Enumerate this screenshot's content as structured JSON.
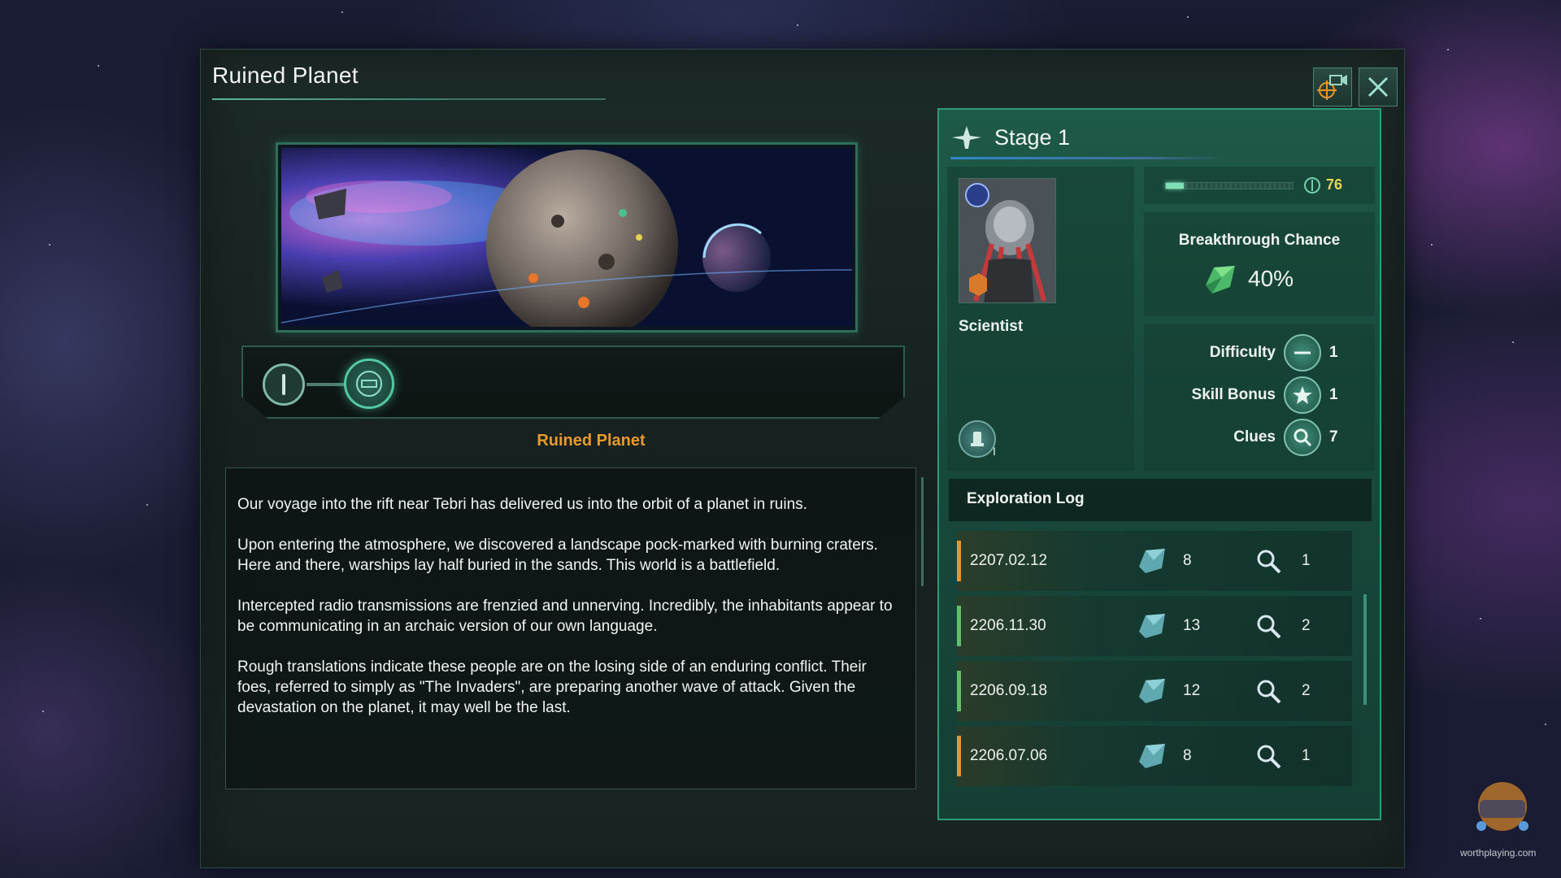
{
  "window": {
    "title": "Ruined Planet",
    "buttons": {
      "camera_icon": "camera-target-icon",
      "close_icon": "close-icon"
    }
  },
  "stage_tracker": {
    "nodes": [
      "stage-1-node",
      "stage-2-node"
    ],
    "location_label": "Ruined Planet"
  },
  "description": {
    "paragraphs": [
      "Our voyage into the rift near Tebri has delivered us into the orbit of a planet in ruins.",
      "Upon entering the atmosphere, we discovered a landscape pock-marked with burning craters. Here and there, warships lay half buried in the sands. This world is a battlefield.",
      "Intercepted radio transmissions are frenzied and unnerving. Incredibly, the inhabitants appear to be communicating in an archaic version of our own language.",
      "Rough translations indicate these people are on the losing side of an enduring conflict. Their foes, referred to simply as \"The Invaders\", are preparing another wave of attack. Given the devastation on the planet, it may well be the last."
    ]
  },
  "stage_panel": {
    "title": "Stage 1",
    "leader": {
      "role": "Scientist",
      "trait_rank": "I"
    },
    "progress": {
      "value": "76",
      "fill_fraction": 0.14
    },
    "breakthrough": {
      "label": "Breakthrough Chance",
      "value": "40%"
    },
    "stats": [
      {
        "label": "Difficulty",
        "value": "1",
        "icon": "difficulty-icon"
      },
      {
        "label": "Skill Bonus",
        "value": "1",
        "icon": "star-icon"
      },
      {
        "label": "Clues",
        "value": "7",
        "icon": "magnifier-icon"
      }
    ],
    "log": {
      "title": "Exploration Log",
      "entries": [
        {
          "date": "2207.02.12",
          "progress": "8",
          "clues": "1",
          "accent": "#e8952a"
        },
        {
          "date": "2206.11.30",
          "progress": "13",
          "clues": "2",
          "accent": "#5fbf6a"
        },
        {
          "date": "2206.09.18",
          "progress": "12",
          "clues": "2",
          "accent": "#5fbf6a"
        },
        {
          "date": "2206.07.06",
          "progress": "8",
          "clues": "1",
          "accent": "#e8952a"
        }
      ]
    }
  },
  "watermark": {
    "text": "worthplaying.com"
  },
  "colors": {
    "accent_orange": "#e89a2c",
    "panel_green": "#1e5a48",
    "progress_yellow": "#e8d55a"
  }
}
